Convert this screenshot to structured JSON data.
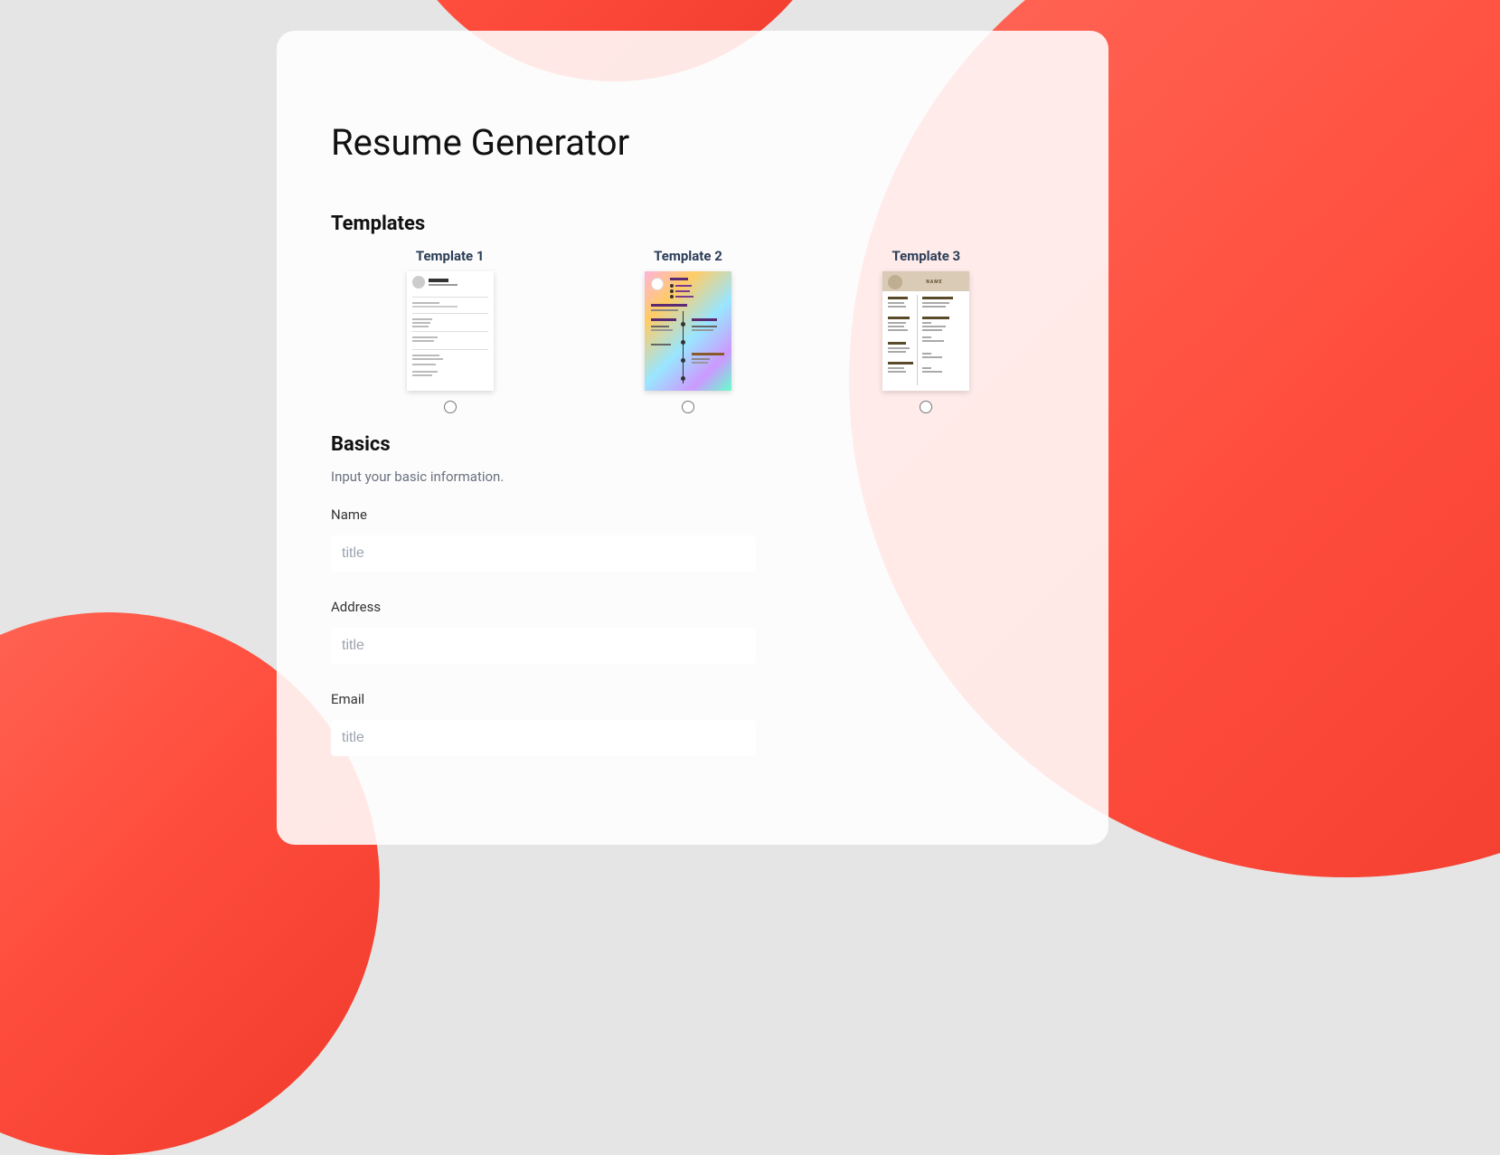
{
  "page": {
    "title": "Resume Generator"
  },
  "templates": {
    "heading": "Templates",
    "items": [
      {
        "label": "Template 1",
        "selected": false
      },
      {
        "label": "Template 2",
        "selected": false
      },
      {
        "label": "Template 3",
        "selected": false
      }
    ]
  },
  "basics": {
    "heading": "Basics",
    "subheading": "Input your basic information.",
    "fields": [
      {
        "label": "Name",
        "placeholder": "title",
        "value": ""
      },
      {
        "label": "Address",
        "placeholder": "title",
        "value": ""
      },
      {
        "label": "Email",
        "placeholder": "title",
        "value": ""
      }
    ]
  },
  "colors": {
    "accent_gradient_start": "#ff6b5b",
    "accent_gradient_end": "#ef3a2a",
    "background": "#e5e5e5",
    "card_bg": "rgba(255,255,255,0.88)"
  }
}
